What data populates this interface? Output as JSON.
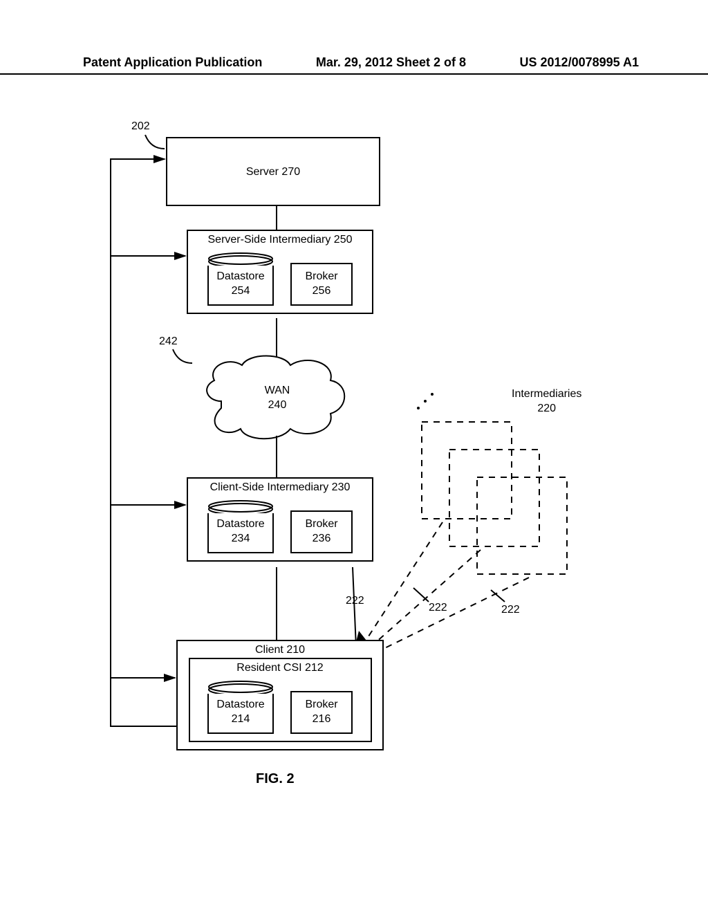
{
  "header": {
    "left": "Patent Application Publication",
    "center": "Mar. 29, 2012  Sheet 2 of 8",
    "right": "US 2012/0078995 A1"
  },
  "refs": {
    "r202": "202",
    "r242": "242",
    "r222a": "222",
    "r222b": "222",
    "intermediaries": "Intermediaries\n220"
  },
  "server": {
    "title": "Server 270"
  },
  "ssi": {
    "title": "Server-Side Intermediary 250",
    "datastore": "Datastore\n254",
    "broker": "Broker\n256"
  },
  "wan": {
    "title": "WAN\n240"
  },
  "csi": {
    "title": "Client-Side Intermediary 230",
    "datastore": "Datastore\n234",
    "broker": "Broker\n236"
  },
  "client": {
    "title_outer": "Client 210",
    "title_inner": "Resident CSI 212",
    "datastore": "Datastore\n214",
    "broker": "Broker\n216"
  },
  "figure": "FIG. 2"
}
